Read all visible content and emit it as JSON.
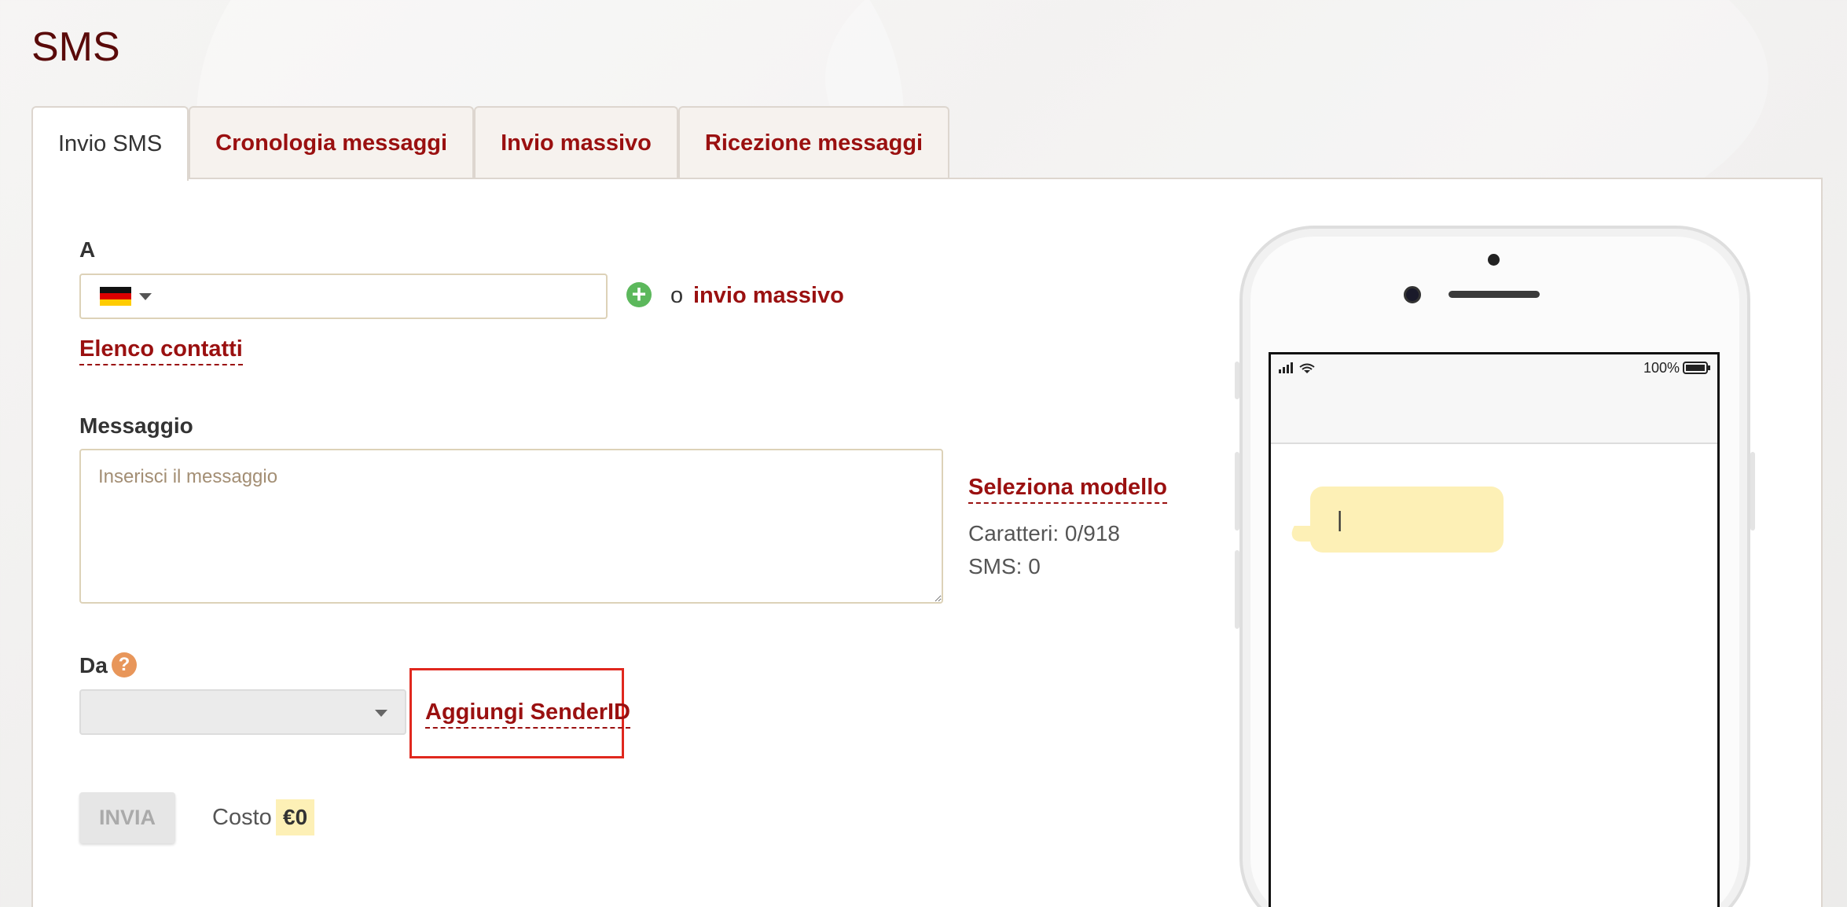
{
  "page": {
    "title": "SMS"
  },
  "tabs": [
    {
      "label": "Invio SMS",
      "active": true
    },
    {
      "label": "Cronologia messaggi",
      "active": false
    },
    {
      "label": "Invio massivo",
      "active": false
    },
    {
      "label": "Ricezione messaggi",
      "active": false
    }
  ],
  "recipient": {
    "label": "A",
    "country": "Germany",
    "flag_icon": "germany-flag-icon",
    "value": "",
    "or_text": "o",
    "bulk_link": "invio massivo",
    "contacts_link": "Elenco contatti"
  },
  "message": {
    "label": "Messaggio",
    "placeholder": "Inserisci il messaggio",
    "value": "",
    "template_link": "Seleziona modello",
    "char_count": "Caratteri: 0/918",
    "sms_count": "SMS: 0"
  },
  "sender": {
    "label": "Da",
    "help_icon": "?",
    "selected": "",
    "add_link": "Aggiungi SenderID"
  },
  "actions": {
    "send_label": "INVIA",
    "cost_label": "Costo",
    "cost_value": "€0"
  },
  "preview": {
    "battery": "100%",
    "bubble_text": "|"
  },
  "colors": {
    "brand": "#9a1010",
    "title": "#5a0a0a",
    "highlight": "#e0281e",
    "bubble": "#fdf0b6",
    "add": "#5cb85c",
    "help": "#e8965a"
  }
}
